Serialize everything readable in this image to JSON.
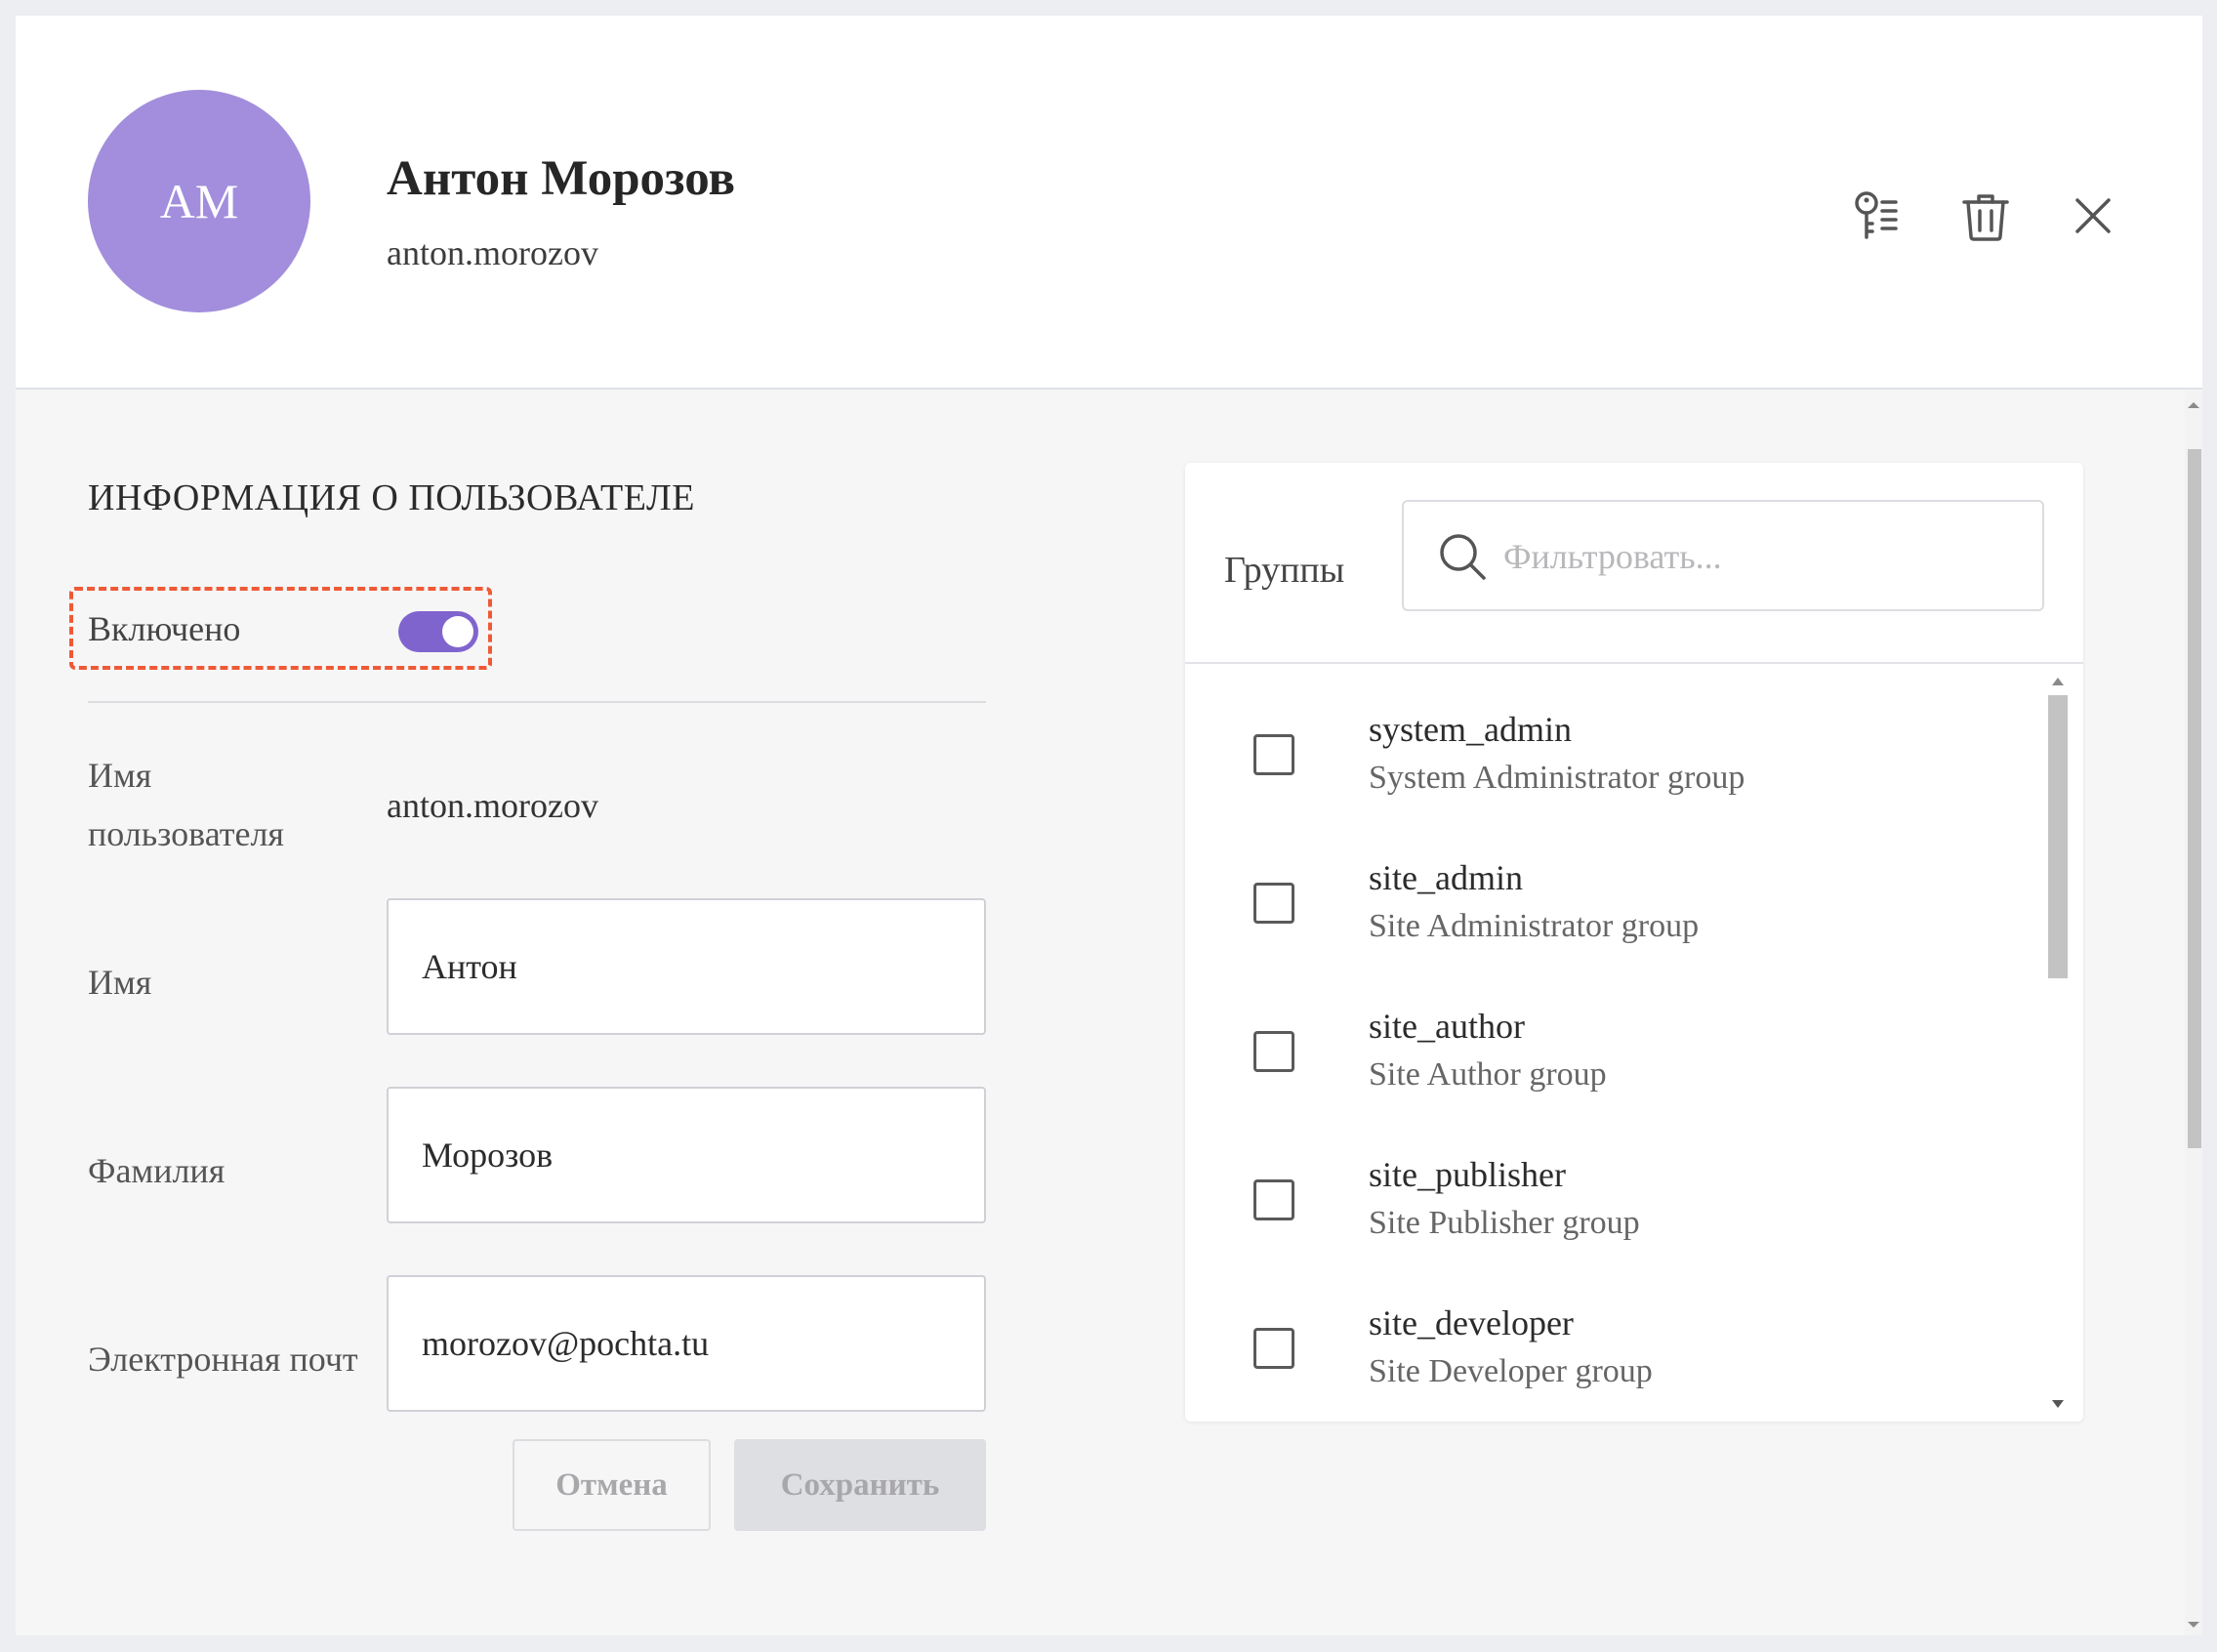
{
  "header": {
    "avatar_initials": "AM",
    "full_name": "Антон Морозов",
    "username": "anton.morozov",
    "icons": [
      "key-list-icon",
      "trash-icon",
      "close-icon"
    ]
  },
  "user_info": {
    "section_title": "ИНФОРМАЦИЯ О ПОЛЬЗОВАТЕЛЕ",
    "enabled_label": "Включено",
    "enabled": true,
    "username_label_line1": "Имя",
    "username_label_line2": "пользователя",
    "username_value": "anton.morozov",
    "first_name_label": "Имя",
    "first_name_value": "Антон",
    "last_name_label": "Фамилия",
    "last_name_value": "Морозов",
    "email_label": "Электронная почт",
    "email_value": "morozov@pochta.tu",
    "cancel_label": "Отмена",
    "save_label": "Сохранить"
  },
  "groups": {
    "label": "Группы",
    "filter_placeholder": "Фильтровать...",
    "items": [
      {
        "name": "system_admin",
        "description": "System Administrator group",
        "checked": false
      },
      {
        "name": "site_admin",
        "description": "Site Administrator group",
        "checked": false
      },
      {
        "name": "site_author",
        "description": "Site Author group",
        "checked": false
      },
      {
        "name": "site_publisher",
        "description": "Site Publisher group",
        "checked": false
      },
      {
        "name": "site_developer",
        "description": "Site Developer group",
        "checked": false
      }
    ]
  },
  "colors": {
    "accent": "#8064ce",
    "avatar": "#a28edc",
    "highlight_border": "#ee5a36"
  }
}
